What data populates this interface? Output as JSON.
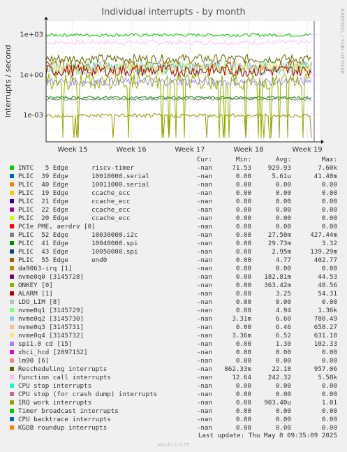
{
  "title": "Individual interrupts - by month",
  "side_label": "RRDTOOL / TOBI OETIKER",
  "footer": {
    "last_update": "Last update: Thu May  8 09:35:09 2025",
    "munin": "Munin 2.0.75"
  },
  "legend_headers": {
    "cur": "Cur:",
    "min": "Min:",
    "avg": "Avg:",
    "max": "Max:"
  },
  "chart_data": {
    "type": "line",
    "title": "Individual interrupts - by month",
    "ylabel": "interrupts / second",
    "yscale": "log",
    "ylim": [
      1e-05,
      10000
    ],
    "yticks": [
      "1e+03",
      "1e+00",
      "1e-03"
    ],
    "x_ticks": [
      "Week 15",
      "Week 16",
      "Week 17",
      "Week 18",
      "Week 19"
    ],
    "grid": true,
    "series": [
      {
        "name": "INTC   5 Edge      riscv-timer",
        "color": "#00cc00",
        "cur": "-nan",
        "min": "71.53",
        "avg": "929.93",
        "max": "7.60k"
      },
      {
        "name": "PLIC  39 Edge      10010000.serial",
        "color": "#0066b3",
        "cur": "-nan",
        "min": "0.00",
        "avg": "5.61u",
        "max": "41.40m"
      },
      {
        "name": "PLIC  40 Edge      10011000.serial",
        "color": "#ff8000",
        "cur": "-nan",
        "min": "0.00",
        "avg": "0.00",
        "max": "0.00"
      },
      {
        "name": "PLIC  19 Edge      ccache_ecc",
        "color": "#ffcc00",
        "cur": "-nan",
        "min": "0.00",
        "avg": "0.00",
        "max": "0.00"
      },
      {
        "name": "PLIC  21 Edge      ccache_ecc",
        "color": "#330099",
        "cur": "-nan",
        "min": "0.00",
        "avg": "0.00",
        "max": "0.00"
      },
      {
        "name": "PLIC  22 Edge      ccache_ecc",
        "color": "#990099",
        "cur": "-nan",
        "min": "0.00",
        "avg": "0.00",
        "max": "0.00"
      },
      {
        "name": "PLIC  20 Edge      ccache_ecc",
        "color": "#ccff00",
        "cur": "-nan",
        "min": "0.00",
        "avg": "0.00",
        "max": "0.00"
      },
      {
        "name": "PCIe PME, aerdrv [0]",
        "color": "#ff0000",
        "cur": "-nan",
        "min": "0.00",
        "avg": "0.00",
        "max": "0.00"
      },
      {
        "name": "PLIC  52 Edge      10030000.i2c",
        "color": "#808080",
        "cur": "-nan",
        "min": "0.00",
        "avg": "27.50m",
        "max": "427.44m"
      },
      {
        "name": "PLIC  41 Edge      10040000.spi",
        "color": "#008f00",
        "cur": "-nan",
        "min": "0.00",
        "avg": "29.73m",
        "max": "3.32"
      },
      {
        "name": "PLIC  43 Edge      10050000.spi",
        "color": "#00487d",
        "cur": "-nan",
        "min": "0.00",
        "avg": "2.95m",
        "max": "139.29m"
      },
      {
        "name": "PLIC  55 Edge      end0",
        "color": "#b35a00",
        "cur": "-nan",
        "min": "0.00",
        "avg": "4.77",
        "max": "402.77"
      },
      {
        "name": "da9063-irq [1]",
        "color": "#b38f00",
        "cur": "-nan",
        "min": "0.00",
        "avg": "0.00",
        "max": "0.00"
      },
      {
        "name": "nvme0q0 [3145728]",
        "color": "#6b006b",
        "cur": "-nan",
        "min": "0.00",
        "avg": "182.81m",
        "max": "44.53"
      },
      {
        "name": "ONKEY [0]",
        "color": "#8fb300",
        "cur": "-nan",
        "min": "0.00",
        "avg": "363.42m",
        "max": "48.56"
      },
      {
        "name": "ALARM [1]",
        "color": "#b30000",
        "cur": "-nan",
        "min": "0.00",
        "avg": "3.25",
        "max": "54.31"
      },
      {
        "name": "LDO_LIM [8]",
        "color": "#bebebe",
        "cur": "-nan",
        "min": "0.00",
        "avg": "0.00",
        "max": "0.00"
      },
      {
        "name": "nvme0q1 [3145729]",
        "color": "#80ff80",
        "cur": "-nan",
        "min": "0.00",
        "avg": "4.94",
        "max": "1.36k"
      },
      {
        "name": "nvme0q2 [3145730]",
        "color": "#80c9ff",
        "cur": "-nan",
        "min": "3.31m",
        "avg": "6.60",
        "max": "780.49"
      },
      {
        "name": "nvme0q3 [3145731]",
        "color": "#ffc080",
        "cur": "-nan",
        "min": "0.00",
        "avg": "6.46",
        "max": "658.27"
      },
      {
        "name": "nvme0q4 [3145732]",
        "color": "#ffe680",
        "cur": "-nan",
        "min": "3.36m",
        "avg": "6.52",
        "max": "631.18"
      },
      {
        "name": "spi1.0 cd [15]",
        "color": "#aa80ff",
        "cur": "-nan",
        "min": "0.00",
        "avg": "1.30",
        "max": "102.33"
      },
      {
        "name": "xhci_hcd [2097152]",
        "color": "#ee00cc",
        "cur": "-nan",
        "min": "0.00",
        "avg": "0.00",
        "max": "0.00"
      },
      {
        "name": "lm90 [6]",
        "color": "#ff8080",
        "cur": "-nan",
        "min": "0.00",
        "avg": "0.00",
        "max": "0.00"
      },
      {
        "name": "Rescheduling interrupts",
        "color": "#666600",
        "cur": "-nan",
        "min": "862.33m",
        "avg": "22.18",
        "max": "957.06"
      },
      {
        "name": "Function call interrupts",
        "color": "#ffbfff",
        "cur": "-nan",
        "min": "12.64",
        "avg": "242.32",
        "max": "5.58k"
      },
      {
        "name": "CPU stop interrupts",
        "color": "#00ffcc",
        "cur": "-nan",
        "min": "0.00",
        "avg": "0.00",
        "max": "0.00"
      },
      {
        "name": "CPU stop (for crash dump) interrupts",
        "color": "#cc6699",
        "cur": "-nan",
        "min": "0.00",
        "avg": "0.00",
        "max": "0.00"
      },
      {
        "name": "IRQ work interrupts",
        "color": "#999900",
        "cur": "-nan",
        "min": "0.00",
        "avg": "903.40u",
        "max": "1.01"
      },
      {
        "name": "Timer broadcast interrupts",
        "color": "#00cc00",
        "cur": "-nan",
        "min": "0.00",
        "avg": "0.00",
        "max": "0.00"
      },
      {
        "name": "CPU backtrace interrupts",
        "color": "#0066b3",
        "cur": "-nan",
        "min": "0.00",
        "avg": "0.00",
        "max": "0.00"
      },
      {
        "name": "KGDB roundup interrupts",
        "color": "#ff8000",
        "cur": "-nan",
        "min": "0.00",
        "avg": "0.00",
        "max": "0.00"
      }
    ]
  }
}
